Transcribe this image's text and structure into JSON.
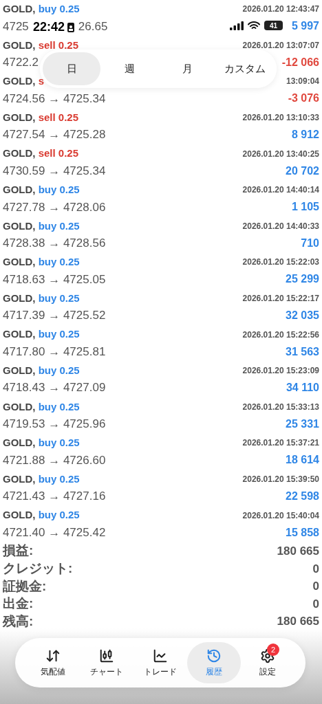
{
  "status_bar": {
    "time": "22:42",
    "battery": "41"
  },
  "period_tabs": [
    {
      "label": "日",
      "selected": true
    },
    {
      "label": "週",
      "selected": false
    },
    {
      "label": "月",
      "selected": false
    },
    {
      "label": "カスタム",
      "selected": false
    }
  ],
  "trades": [
    {
      "symbol": "GOLD,",
      "side": "buy 0.25",
      "color": "#2f86e6",
      "time": "2026.01.20 12:43:47",
      "price": "4725",
      "price_tail": "26.65",
      "profit": "5 997",
      "kind": "profit"
    },
    {
      "symbol": "GOLD,",
      "side": "sell 0.25",
      "color": "#d93a30",
      "time": "2026.01.20 13:07:07",
      "price": "4722.2",
      "profit": "-12 066",
      "kind": "loss"
    },
    {
      "symbol": "GOLD,",
      "side": "s",
      "color": "#d93a30",
      "time": "13:09:04",
      "price": "4724.56 → 4725.34",
      "profit": "-3 076",
      "kind": "loss"
    },
    {
      "symbol": "GOLD,",
      "side": "sell 0.25",
      "color": "#d93a30",
      "time": "2026.01.20 13:10:33",
      "price": "4727.54 → 4725.28",
      "profit": "8 912",
      "kind": "profit"
    },
    {
      "symbol": "GOLD,",
      "side": "sell 0.25",
      "color": "#d93a30",
      "time": "2026.01.20 13:40:25",
      "price": "4730.59 → 4725.34",
      "profit": "20 702",
      "kind": "profit"
    },
    {
      "symbol": "GOLD,",
      "side": "buy 0.25",
      "color": "#2f86e6",
      "time": "2026.01.20 14:40:14",
      "price": "4727.78 → 4728.06",
      "profit": "1 105",
      "kind": "profit"
    },
    {
      "symbol": "GOLD,",
      "side": "buy 0.25",
      "color": "#2f86e6",
      "time": "2026.01.20 14:40:33",
      "price": "4728.38 → 4728.56",
      "profit": "710",
      "kind": "profit"
    },
    {
      "symbol": "GOLD,",
      "side": "buy 0.25",
      "color": "#2f86e6",
      "time": "2026.01.20 15:22:03",
      "price": "4718.63 → 4725.05",
      "profit": "25 299",
      "kind": "profit"
    },
    {
      "symbol": "GOLD,",
      "side": "buy 0.25",
      "color": "#2f86e6",
      "time": "2026.01.20 15:22:17",
      "price": "4717.39 → 4725.52",
      "profit": "32 035",
      "kind": "profit"
    },
    {
      "symbol": "GOLD,",
      "side": "buy 0.25",
      "color": "#2f86e6",
      "time": "2026.01.20 15:22:56",
      "price": "4717.80 → 4725.81",
      "profit": "31 563",
      "kind": "profit"
    },
    {
      "symbol": "GOLD,",
      "side": "buy 0.25",
      "color": "#2f86e6",
      "time": "2026.01.20 15:23:09",
      "price": "4718.43 → 4727.09",
      "profit": "34 110",
      "kind": "profit"
    },
    {
      "symbol": "GOLD,",
      "side": "buy 0.25",
      "color": "#2f86e6",
      "time": "2026.01.20 15:33:13",
      "price": "4719.53 → 4725.96",
      "profit": "25 331",
      "kind": "profit"
    },
    {
      "symbol": "GOLD,",
      "side": "buy 0.25",
      "color": "#2f86e6",
      "time": "2026.01.20 15:37:21",
      "price": "4721.88 → 4726.60",
      "profit": "18 614",
      "kind": "profit"
    },
    {
      "symbol": "GOLD,",
      "side": "buy 0.25",
      "color": "#2f86e6",
      "time": "2026.01.20 15:39:50",
      "price": "4721.43 → 4727.16",
      "profit": "22 598",
      "kind": "profit"
    },
    {
      "symbol": "GOLD,",
      "side": "buy 0.25",
      "color": "#2f86e6",
      "time": "2026.01.20 15:40:04",
      "price": "4721.40 → 4725.42",
      "profit": "15 858",
      "kind": "profit"
    }
  ],
  "summary": [
    {
      "label": "損益:",
      "value": "180 665"
    },
    {
      "label": "クレジット:",
      "value": "0"
    },
    {
      "label": "証拠金:",
      "value": "0"
    },
    {
      "label": "出金:",
      "value": "0"
    },
    {
      "label": "残高:",
      "value": "180 665"
    }
  ],
  "nav": [
    {
      "label": "気配値",
      "selected": false
    },
    {
      "label": "チャート",
      "selected": false
    },
    {
      "label": "トレード",
      "selected": false
    },
    {
      "label": "履歴",
      "selected": true
    },
    {
      "label": "設定",
      "selected": false,
      "badge": "2"
    }
  ]
}
